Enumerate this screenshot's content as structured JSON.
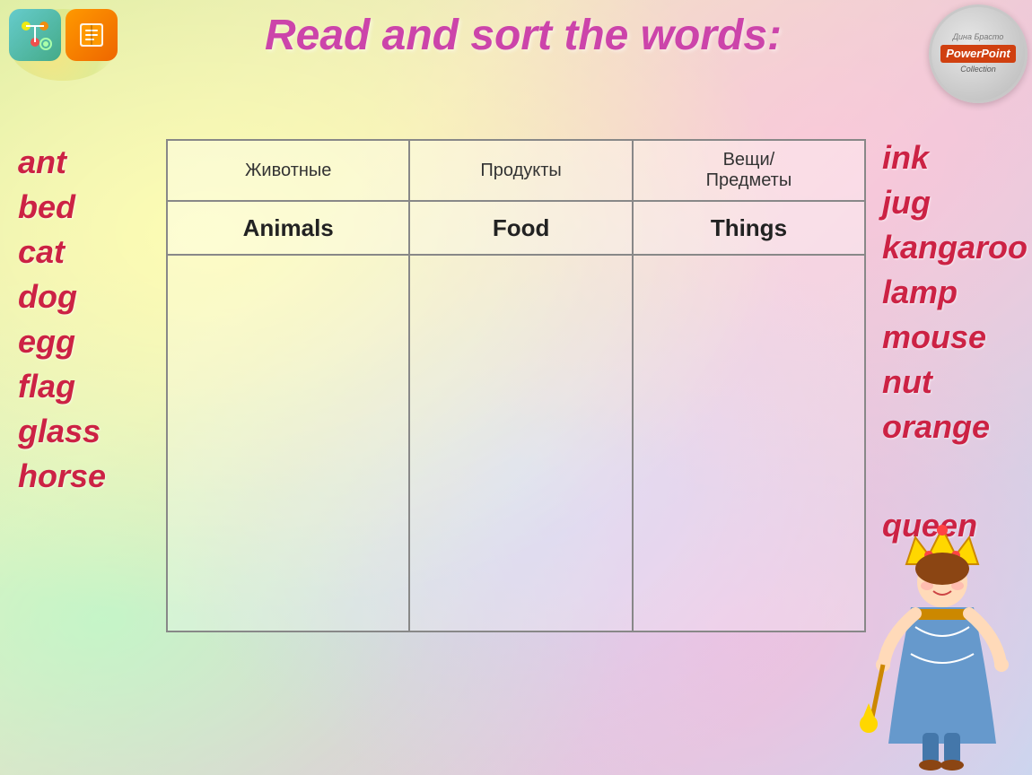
{
  "header": {
    "title": "Read and sort the words:"
  },
  "left_words": [
    "ant",
    "bed",
    "cat",
    "dog",
    "egg",
    "flag",
    "glass",
    "horse"
  ],
  "right_words": [
    "ink",
    "jug",
    "kangaroo",
    "lamp",
    "mouse",
    "nut",
    "orange",
    "queen"
  ],
  "table": {
    "russian_headers": [
      "Животные",
      "Продукты",
      "Вещи/\nПредметы"
    ],
    "english_headers": [
      "Animals",
      "Food",
      "Things"
    ]
  },
  "badge": {
    "logo": "P",
    "line1": "PowerPoint",
    "line2": "Collection"
  }
}
